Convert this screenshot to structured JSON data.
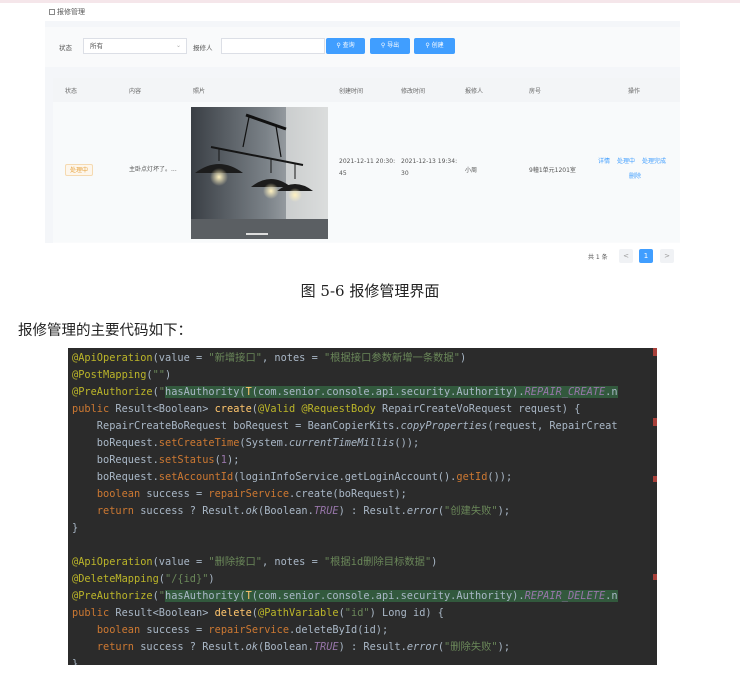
{
  "header_title": "报修管理",
  "filters": {
    "status_label": "状态",
    "status_value": "所有",
    "reporter_label": "报修人",
    "reporter_value": "",
    "buttons": [
      "查询",
      "导出",
      "创建"
    ]
  },
  "table": {
    "headers": [
      "状态",
      "内容",
      "照片",
      "创建时间",
      "修改时间",
      "报修人",
      "房号",
      "操作"
    ],
    "row": {
      "status": "处理中",
      "content": "主卧点灯坏了。...",
      "created_line1": "2021-12-11 20:30:",
      "created_line2": "45",
      "modified_line1": "2021-12-13 19:34:",
      "modified_line2": "30",
      "reporter": "小周",
      "room": "9幢1单元1201室",
      "actions": [
        "详情",
        "处理中",
        "处理完成",
        "删除"
      ]
    }
  },
  "pagination": {
    "total": "共 1 条",
    "prev": "<",
    "current": "1",
    "next": ">"
  },
  "caption": "图 5-6 报修管理界面",
  "intro": "报修管理的主要代码如下：",
  "code_lines": [
    "@ApiOperation(value = \"新增接口\", notes = \"根据接口参数新增一条数据\")",
    "@PostMapping(\"\")",
    "@PreAuthorize(\"hasAuthority(T(com.senior.console.api.security.Authority).REPAIR_CREATE.n",
    "public Result<Boolean> create(@Valid @RequestBody RepairCreateVoRequest request) {",
    "    RepairCreateBoRequest boRequest = BeanCopierKits.copyProperties(request, RepairCreat",
    "    boRequest.setCreateTime(System.currentTimeMillis());",
    "    boRequest.setStatus(1);",
    "    boRequest.setAccountId(loginInfoService.getLoginAccount().getId());",
    "    boolean success = repairService.create(boRequest);",
    "    return success ? Result.ok(Boolean.TRUE) : Result.error(\"创建失败\");",
    "}",
    "",
    "@ApiOperation(value = \"删除接口\", notes = \"根据id删除目标数据\")",
    "@DeleteMapping(\"/{id}\")",
    "@PreAuthorize(\"hasAuthority(T(com.senior.console.api.security.Authority).REPAIR_DELETE.n",
    "public Result<Boolean> delete(@PathVariable(\"id\") Long id) {",
    "    boolean success = repairService.deleteById(id);",
    "    return success ? Result.ok(Boolean.TRUE) : Result.error(\"删除失败\");",
    "}"
  ]
}
